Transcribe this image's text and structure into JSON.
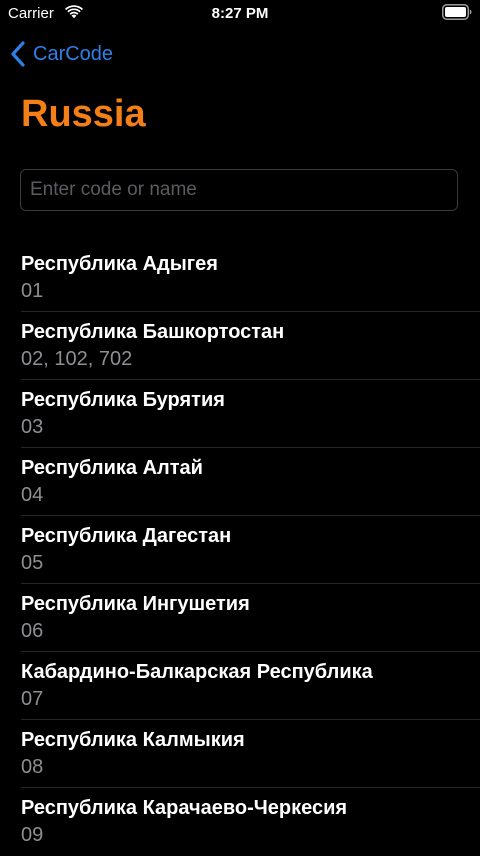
{
  "status_bar": {
    "carrier": "Carrier",
    "time": "8:27 PM",
    "wifi_icon": "wifi-icon",
    "battery_icon": "battery-icon"
  },
  "nav": {
    "back_label": "CarCode",
    "back_icon": "chevron-left-icon",
    "title": "Russia"
  },
  "search": {
    "placeholder": "Enter code or name",
    "value": ""
  },
  "colors": {
    "accent_blue": "#2f7fe8",
    "title_orange": "#f47f17",
    "background": "#000000",
    "secondary_text": "#8e8e93"
  },
  "regions": [
    {
      "name": "Республика Адыгея",
      "codes": "01"
    },
    {
      "name": "Республика Башкортостан",
      "codes": "02, 102, 702"
    },
    {
      "name": "Республика Бурятия",
      "codes": "03"
    },
    {
      "name": "Республика Алтай",
      "codes": "04"
    },
    {
      "name": "Республика Дагестан",
      "codes": "05"
    },
    {
      "name": "Республика Ингушетия",
      "codes": "06"
    },
    {
      "name": "Кабардино-Балкарская Республика",
      "codes": "07"
    },
    {
      "name": "Республика Калмыкия",
      "codes": "08"
    },
    {
      "name": "Республика Карачаево-Черкесия",
      "codes": "09"
    }
  ]
}
